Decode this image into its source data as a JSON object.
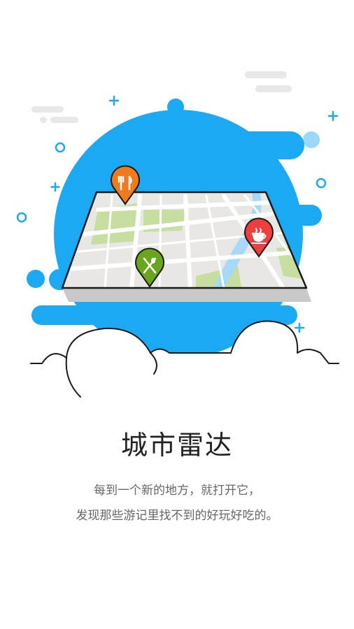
{
  "onboarding": {
    "title": "城市雷达",
    "description_line1": "每到一个新的地方，就打开它，",
    "description_line2": "发现那些游记里找不到的好玩好吃的。"
  },
  "illustration": {
    "map_icon": "folded-map-icon",
    "pins": [
      {
        "icon": "utensils-icon",
        "color": "#F07A1E"
      },
      {
        "icon": "coffee-cup-icon",
        "color": "#EF3E3E"
      },
      {
        "icon": "fork-spoon-icon",
        "color": "#6AA51E"
      }
    ],
    "colors": {
      "blob_blue": "#1BA9F4",
      "map_land": "#E9E7E3",
      "map_park": "#C6DE9F",
      "map_river": "#A6D8F7",
      "outline": "#1A1A1A"
    }
  }
}
